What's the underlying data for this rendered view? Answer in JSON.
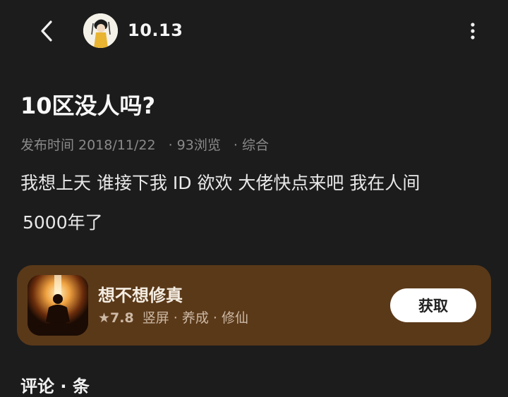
{
  "header": {
    "username": "10.13"
  },
  "post": {
    "title": "10区没人吗?",
    "meta": {
      "published": "发布时间 2018/11/22",
      "views": "93浏览",
      "category": "综合"
    },
    "body_line1": "我想上天 谁接下我 ID 欲欢 大佬快点来吧 我在人间",
    "body_line2": "5000年了"
  },
  "app_card": {
    "name": "想不想修真",
    "rating": "7.8",
    "tags": "竖屏 · 养成 · 修仙",
    "get_label": "获取",
    "bg_color": "#5a3919"
  },
  "comments": {
    "heading_partial": "评论 · 条"
  }
}
